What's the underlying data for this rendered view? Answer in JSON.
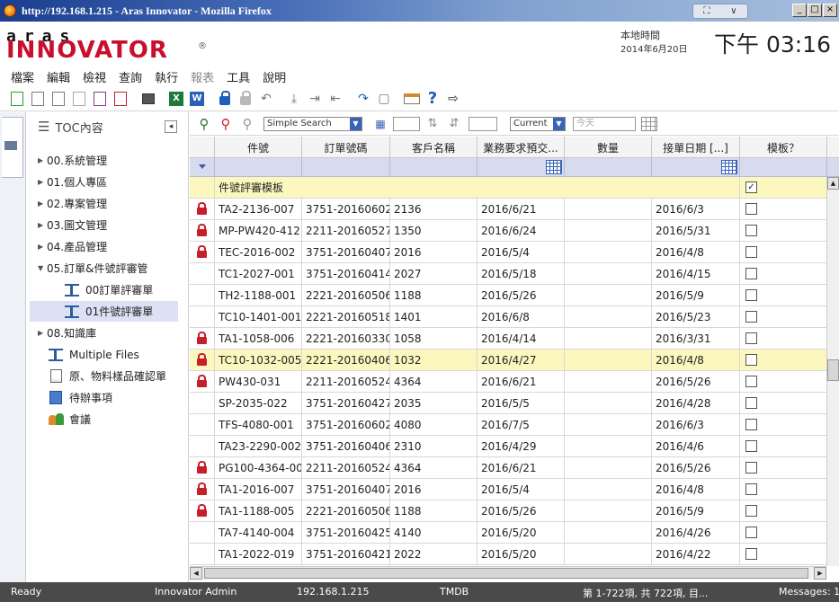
{
  "window": {
    "title": "http://192.168.1.215 - Aras Innovator - Mozilla Firefox"
  },
  "header": {
    "logo_top": "aras",
    "logo_bottom": "INNOVATOR",
    "logo_reg": "®",
    "clock_label": "本地時間",
    "clock_date": "2014年6月20日",
    "clock_time": "下午 03:16"
  },
  "menu": {
    "items": [
      "檔案",
      "編輯",
      "檢視",
      "查詢",
      "執行",
      "報表",
      "工具",
      "說明"
    ]
  },
  "toc": {
    "title": "TOC內容",
    "items": [
      {
        "label": "00.系統管理",
        "kind": "folder"
      },
      {
        "label": "01.個人專區",
        "kind": "folder"
      },
      {
        "label": "02.專案管理",
        "kind": "folder"
      },
      {
        "label": "03.圖文管理",
        "kind": "folder"
      },
      {
        "label": "04.產品管理",
        "kind": "folder"
      },
      {
        "label": "05.訂單&件號評審管",
        "kind": "folder-open"
      },
      {
        "label": "00訂單評審單",
        "kind": "child"
      },
      {
        "label": "01件號評審單",
        "kind": "child-selected"
      },
      {
        "label": "08.知識庫",
        "kind": "folder"
      },
      {
        "label": "Multiple Files",
        "kind": "item-beam"
      },
      {
        "label": "原、物料樣品確認單",
        "kind": "item-doc"
      },
      {
        "label": "待辦事項",
        "kind": "item-task"
      },
      {
        "label": "會議",
        "kind": "item-meet"
      }
    ]
  },
  "gridbar": {
    "search_mode": "Simple Search",
    "version": "Current",
    "date_placeholder": "今天"
  },
  "grid": {
    "columns": [
      "",
      "件號",
      "訂單號碼",
      "客戶名稱",
      "業務要求預交...",
      "數量",
      "接單日期 [...]",
      "模板？"
    ],
    "template_row": {
      "label": "件號評審模板",
      "checked": "✓"
    },
    "rows": [
      {
        "locked": true,
        "part": "TA2-2136-007",
        "order": "3751-20160602...",
        "customer": "2136",
        "due": "2016/6/21",
        "qty": "",
        "recv": "2016/6/3"
      },
      {
        "locked": true,
        "part": "MP-PW420-412...",
        "order": "2211-20160527...",
        "customer": "1350",
        "due": "2016/6/24",
        "qty": "",
        "recv": "2016/5/31"
      },
      {
        "locked": true,
        "part": "TEC-2016-002",
        "order": "3751-20160407...",
        "customer": "2016",
        "due": "2016/5/4",
        "qty": "",
        "recv": "2016/4/8"
      },
      {
        "locked": false,
        "part": "TC1-2027-001",
        "order": "3751-20160414...",
        "customer": "2027",
        "due": "2016/5/18",
        "qty": "",
        "recv": "2016/4/15"
      },
      {
        "locked": false,
        "part": "TH2-1188-001",
        "order": "2221-20160506...",
        "customer": "1188",
        "due": "2016/5/26",
        "qty": "",
        "recv": "2016/5/9"
      },
      {
        "locked": false,
        "part": "TC10-1401-001",
        "order": "2221-20160518...",
        "customer": "1401",
        "due": "2016/6/8",
        "qty": "",
        "recv": "2016/5/23"
      },
      {
        "locked": true,
        "part": "TA1-1058-006",
        "order": "2221-20160330...",
        "customer": "1058",
        "due": "2016/4/14",
        "qty": "",
        "recv": "2016/3/31"
      },
      {
        "locked": true,
        "part": "TC10-1032-005",
        "order": "2221-20160406...",
        "customer": "1032",
        "due": "2016/4/27",
        "qty": "",
        "recv": "2016/4/8",
        "highlight": true
      },
      {
        "locked": true,
        "part": "PW430-031",
        "order": "2211-20160524...",
        "customer": "4364",
        "due": "2016/6/21",
        "qty": "",
        "recv": "2016/5/26"
      },
      {
        "locked": false,
        "part": "SP-2035-022",
        "order": "3751-20160427...",
        "customer": "2035",
        "due": "2016/5/5",
        "qty": "",
        "recv": "2016/4/28"
      },
      {
        "locked": false,
        "part": "TFS-4080-001",
        "order": "3751-20160602...",
        "customer": "4080",
        "due": "2016/7/5",
        "qty": "",
        "recv": "2016/6/3"
      },
      {
        "locked": false,
        "part": "TA23-2290-002",
        "order": "3751-20160406...",
        "customer": "2310",
        "due": "2016/4/29",
        "qty": "",
        "recv": "2016/4/6"
      },
      {
        "locked": true,
        "part": "PG100-4364-002",
        "order": "2211-20160524...",
        "customer": "4364",
        "due": "2016/6/21",
        "qty": "",
        "recv": "2016/5/26"
      },
      {
        "locked": true,
        "part": "TA1-2016-007",
        "order": "3751-20160407...",
        "customer": "2016",
        "due": "2016/5/4",
        "qty": "",
        "recv": "2016/4/8"
      },
      {
        "locked": true,
        "part": "TA1-1188-005",
        "order": "2221-20160506...",
        "customer": "1188",
        "due": "2016/5/26",
        "qty": "",
        "recv": "2016/5/9"
      },
      {
        "locked": false,
        "part": "TA7-4140-004",
        "order": "3751-20160425...",
        "customer": "4140",
        "due": "2016/5/20",
        "qty": "",
        "recv": "2016/4/26"
      },
      {
        "locked": false,
        "part": "TA1-2022-019",
        "order": "3751-20160421...",
        "customer": "2022",
        "due": "2016/5/20",
        "qty": "",
        "recv": "2016/4/22"
      }
    ]
  },
  "status": {
    "state": "Ready",
    "user": "Innovator Admin",
    "server": "192.168.1.215",
    "db": "TMDB",
    "paging": "第 1-722項, 共 722項, 目...",
    "messages": "Messages: 1"
  }
}
